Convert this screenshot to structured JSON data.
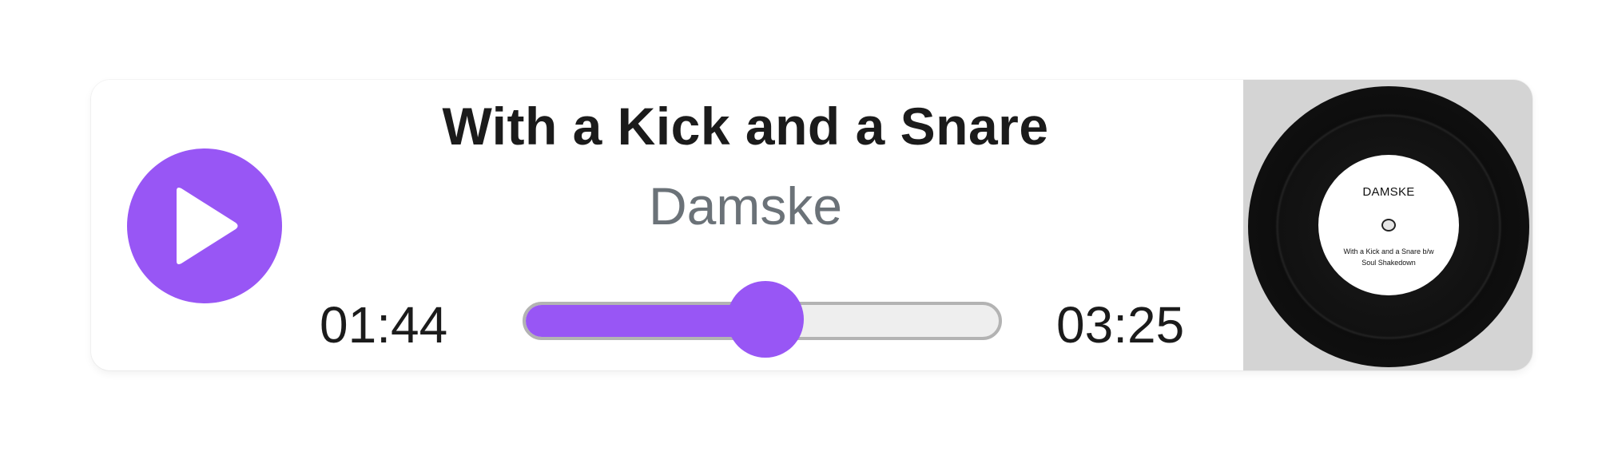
{
  "colors": {
    "accent": "#9856f5",
    "track_border": "#b3b3b3",
    "track_bg": "#eeeeee",
    "artist_text": "#6b7278",
    "art_panel_bg": "#d4d4d4"
  },
  "track": {
    "title": "With a Kick and a Snare",
    "artist": "Damske"
  },
  "playback": {
    "elapsed": "01:44",
    "total": "03:25",
    "progress": 0.507,
    "play_icon": "play-icon"
  },
  "album_art": {
    "label_brand": "DAMSKE",
    "label_line1": "With a Kick and a Snare b/w",
    "label_line2": "Soul Shakedown"
  }
}
